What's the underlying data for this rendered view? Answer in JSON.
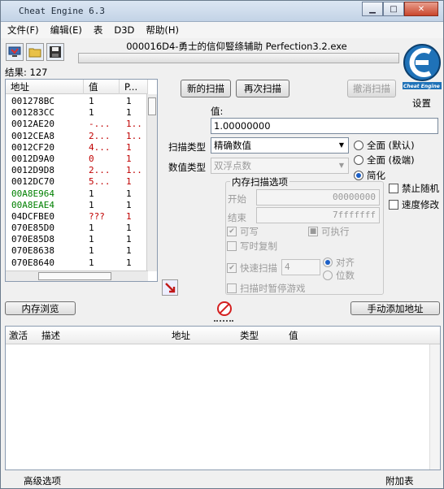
{
  "window": {
    "title": "Cheat Engine 6.3",
    "minimize": "▁",
    "maximize": "□",
    "close": "✕"
  },
  "menu": [
    "文件(F)",
    "编辑(E)",
    "表",
    "D3D",
    "帮助(H)"
  ],
  "process_title": "000016D4-勇士的信仰豎绦辅助   Perfection3.2.exe",
  "progress_fraction": 0,
  "results": "结果: 127",
  "settings_label": "设置",
  "logo_text": "Cheat Engine",
  "address_list": {
    "headers": [
      "地址",
      "值",
      "P..."
    ],
    "rows": [
      {
        "address": "001278BC",
        "value": "1",
        "previous": "1",
        "addr_color": "#000000",
        "val_color": "#000000"
      },
      {
        "address": "001283CC",
        "value": "1",
        "previous": "1",
        "addr_color": "#000000",
        "val_color": "#000000"
      },
      {
        "address": "0012AE20",
        "value": "-...",
        "previous": "1..",
        "addr_color": "#000000",
        "val_color": "#c00000"
      },
      {
        "address": "0012CEA8",
        "value": "2...",
        "previous": "1..",
        "addr_color": "#000000",
        "val_color": "#c00000"
      },
      {
        "address": "0012CF20",
        "value": "4...",
        "previous": "1",
        "addr_color": "#000000",
        "val_color": "#c00000"
      },
      {
        "address": "0012D9A0",
        "value": "0",
        "previous": "1",
        "addr_color": "#000000",
        "val_color": "#c00000"
      },
      {
        "address": "0012D9D8",
        "value": "2...",
        "previous": "1..",
        "addr_color": "#000000",
        "val_color": "#c00000"
      },
      {
        "address": "0012DC70",
        "value": "5...",
        "previous": "1",
        "addr_color": "#000000",
        "val_color": "#c00000"
      },
      {
        "address": "00A8E964",
        "value": "1",
        "previous": "1",
        "addr_color": "#008000",
        "val_color": "#000000"
      },
      {
        "address": "00A8EAE4",
        "value": "1",
        "previous": "1",
        "addr_color": "#008000",
        "val_color": "#000000"
      },
      {
        "address": "04DCFBE0",
        "value": "???",
        "previous": "1",
        "addr_color": "#000000",
        "val_color": "#c00000"
      },
      {
        "address": "070E85D0",
        "value": "1",
        "previous": "1",
        "addr_color": "#000000",
        "val_color": "#000000"
      },
      {
        "address": "070E85D8",
        "value": "1",
        "previous": "1",
        "addr_color": "#000000",
        "val_color": "#000000"
      },
      {
        "address": "070E8638",
        "value": "1",
        "previous": "1",
        "addr_color": "#000000",
        "val_color": "#000000"
      },
      {
        "address": "070E8640",
        "value": "1",
        "previous": "1",
        "addr_color": "#000000",
        "val_color": "#000000"
      },
      {
        "address": "070E8698",
        "value": "1",
        "previous": "1",
        "addr_color": "#000000",
        "val_color": "#000000"
      }
    ]
  },
  "buttons": {
    "new_scan": "新的扫描",
    "next_scan": "再次扫描",
    "undo_scan": "撤消扫描",
    "memory_view": "内存浏览",
    "add_address": "手动添加地址"
  },
  "scan": {
    "value_label": "值:",
    "value": "1.00000000",
    "scan_type_label": "扫描类型",
    "scan_type": "精确数值",
    "value_type_label": "数值类型",
    "value_type": "双浮点数",
    "radio_full_default": "全面 (默认)",
    "radio_full_extreme": "全面 (极端)",
    "radio_simple": "简化",
    "disable_random": "禁止随机",
    "speedhack": "速度修改"
  },
  "memory_options": {
    "title": "内存扫描选项",
    "start_label": "开始",
    "start_value": "00000000",
    "stop_label": "结束",
    "stop_value": "7fffffff",
    "writable": "可写",
    "executable": "可执行",
    "copy_on_write": "写时复制",
    "fast_scan": "快速扫描",
    "fast_scan_value": "4",
    "alignment": "对齐",
    "last_digits": "位数",
    "pause_game": "扫描时暂停游戏"
  },
  "cheat_table": {
    "headers": [
      "激活",
      "描述",
      "地址",
      "类型",
      "值"
    ]
  },
  "status": {
    "advanced": "高级选项",
    "table_extras": "附加表"
  },
  "colors": {
    "accent_blue": "#1b5fc7",
    "stop_red": "#d42020",
    "logo_blue": "#1f72b8"
  }
}
